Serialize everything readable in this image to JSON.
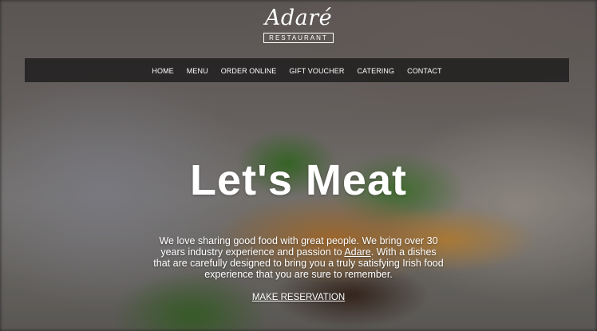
{
  "logo": {
    "wordmark": "Adaré",
    "tagline": "RESTAURANT"
  },
  "nav": {
    "items": [
      {
        "label": "HOME"
      },
      {
        "label": "MENU"
      },
      {
        "label": "ORDER ONLINE"
      },
      {
        "label": "GIFT VOUCHER"
      },
      {
        "label": "CATERING"
      },
      {
        "label": "CONTACT"
      }
    ]
  },
  "hero": {
    "headline": "Let's Meat",
    "intro_part1": "We love sharing good food with great people. We bring over 30 years industry experience and passion to ",
    "intro_link": "Adare",
    "intro_part2": ". With a dishes that are carefully designed to bring you a truly satisfying Irish food experience that you are sure to remember.",
    "cta_label": "MAKE RESERVATION"
  }
}
